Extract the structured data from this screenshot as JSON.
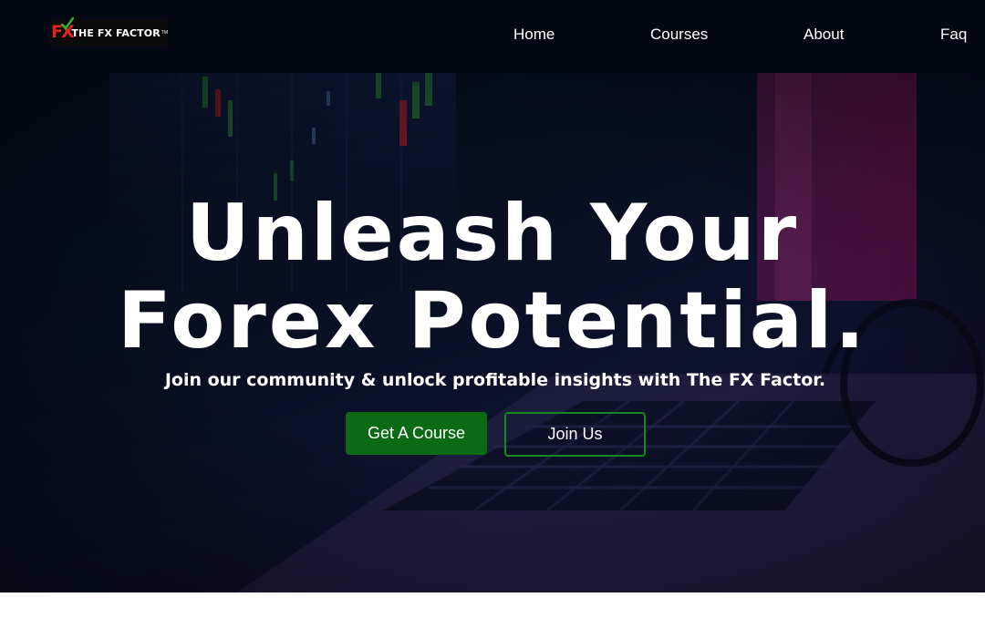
{
  "brand": {
    "logo_mark": "FX",
    "logo_text": "THE FX FACTOR",
    "logo_tm": "TM",
    "accent_red": "#e2231a",
    "accent_green": "#17871f"
  },
  "nav": {
    "items": [
      {
        "label": "Home"
      },
      {
        "label": "Courses"
      },
      {
        "label": "About"
      },
      {
        "label": "Faq"
      }
    ]
  },
  "hero": {
    "title_line1": "Unleash Your",
    "title_line2": "Forex Potential.",
    "subtitle": "Join our community & unlock profitable insights with The FX Factor.",
    "primary_button": "Get A Course",
    "secondary_button": "Join Us",
    "primary_color": "#0b6a14"
  }
}
